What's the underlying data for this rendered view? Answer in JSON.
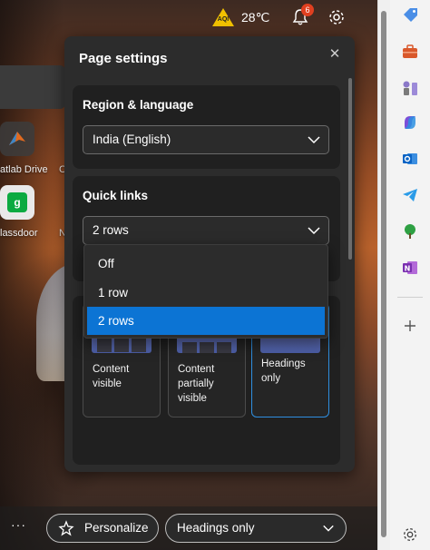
{
  "topbar": {
    "weather_badge": "AQI",
    "temperature": "28℃",
    "notification_count": "6"
  },
  "shortcuts": [
    {
      "label": "atlab Drive",
      "icon": "matlab-icon"
    },
    {
      "label": "C",
      "icon": ""
    },
    {
      "label": "lassdoor",
      "icon": "glassdoor-icon"
    },
    {
      "label": "N",
      "icon": ""
    }
  ],
  "panel": {
    "title": "Page settings",
    "region_section": {
      "title": "Region & language",
      "selected": "India (English)"
    },
    "quick_links_section": {
      "title": "Quick links",
      "selected": "2 rows",
      "options": [
        "Off",
        "1 row",
        "2 rows"
      ],
      "selected_index": 2
    },
    "layout_cards": [
      {
        "line1": "Content",
        "line2": "visible",
        "line3": ""
      },
      {
        "line1": "Content",
        "line2": "partially",
        "line3": "visible"
      },
      {
        "line1": "Headings",
        "line2": "only",
        "line3": ""
      }
    ],
    "active_card_index": 2
  },
  "bottom": {
    "more_label": "···",
    "personalize_label": "Personalize",
    "layout_select_label": "Headings only"
  },
  "sidebar_icons": [
    "tag-icon",
    "briefcase-icon",
    "chess-icon",
    "copilot-icon",
    "outlook-icon",
    "telegram-icon",
    "tree-icon",
    "onenote-icon",
    "add-icon",
    "settings-icon"
  ],
  "colors": {
    "accent": "#0c74d4",
    "panel_bg": "#2c2c2c",
    "section_bg": "#202020"
  }
}
